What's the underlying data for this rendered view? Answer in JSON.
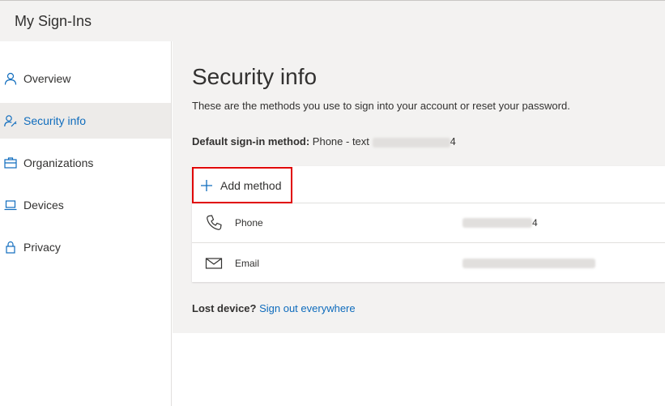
{
  "header": {
    "app_title": "My Sign-Ins"
  },
  "sidebar": {
    "items": [
      {
        "label": "Overview",
        "icon": "person-icon",
        "active": false
      },
      {
        "label": "Security info",
        "icon": "person-key-icon",
        "active": true
      },
      {
        "label": "Organizations",
        "icon": "briefcase-icon",
        "active": false
      },
      {
        "label": "Devices",
        "icon": "laptop-icon",
        "active": false
      },
      {
        "label": "Privacy",
        "icon": "lock-icon",
        "active": false
      }
    ]
  },
  "main": {
    "title": "Security info",
    "description": "These are the methods you use to sign into your account or reset your password.",
    "default_method": {
      "label": "Default sign-in method:",
      "value": "Phone - text",
      "value_suffix": "4"
    },
    "add_method_label": "Add method",
    "methods": [
      {
        "type": "Phone",
        "icon": "phone-icon",
        "value_suffix": "4"
      },
      {
        "type": "Email",
        "icon": "mail-icon",
        "value_suffix": ""
      }
    ],
    "lost_device": {
      "label": "Lost device?",
      "link": "Sign out everywhere"
    }
  },
  "colors": {
    "accent": "#0f6cbd",
    "highlight_border": "#e00000",
    "header_bg": "#f3f2f1",
    "active_nav_bg": "#edebe9"
  }
}
